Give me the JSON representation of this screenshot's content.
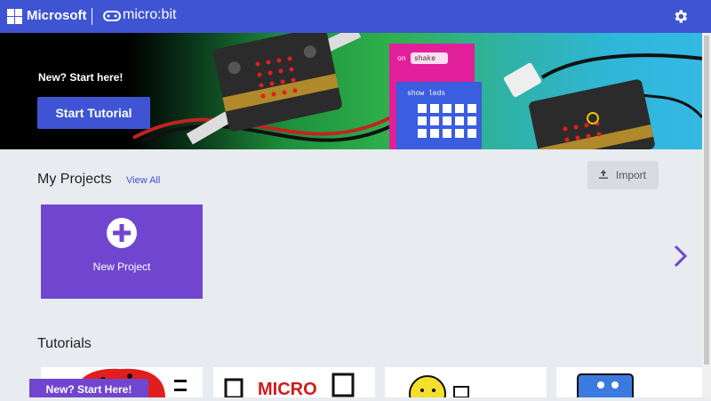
{
  "header": {
    "brand": "Microsoft",
    "product": "micro:bit",
    "icons": [
      "microsoft-logo-icon",
      "microbit-logo-icon",
      "gear-icon"
    ],
    "colors": {
      "bar": "#3e54d3"
    }
  },
  "hero": {
    "title": "New? Start here!",
    "button": "Start Tutorial",
    "block_on": "on",
    "block_event": "shake",
    "block_show": "show leds"
  },
  "projects": {
    "title": "My Projects",
    "view_all": "View All",
    "import": "Import",
    "new_project": "New Project"
  },
  "tutorials": {
    "title": "Tutorials",
    "badge": "New? Start Here!",
    "card_text_2": "MICRO"
  }
}
